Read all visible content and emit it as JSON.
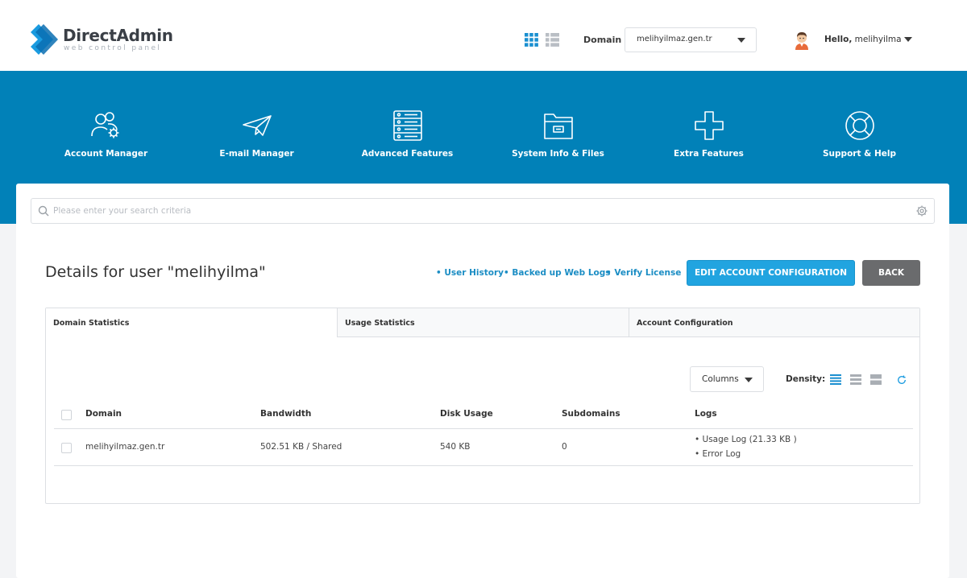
{
  "app": {
    "logo_title": "DirectAdmin",
    "logo_subtitle": "web control panel"
  },
  "header": {
    "domain_label": "Domain",
    "domain_value": "melihyilmaz.gen.tr",
    "hello_prefix": "Hello,",
    "username": "melihyilma"
  },
  "nav": [
    {
      "label": "Account Manager",
      "icon": "users-gear-icon"
    },
    {
      "label": "E-mail Manager",
      "icon": "paper-plane-icon"
    },
    {
      "label": "Advanced Features",
      "icon": "server-icon"
    },
    {
      "label": "System Info & Files",
      "icon": "folder-icon"
    },
    {
      "label": "Extra Features",
      "icon": "plus-icon"
    },
    {
      "label": "Support & Help",
      "icon": "lifebuoy-icon"
    }
  ],
  "search": {
    "placeholder": "Please enter your search criteria"
  },
  "page": {
    "title": "Details for user \"melihyilma\"",
    "links": [
      "User History",
      "Backed up Web Logs",
      "Verify License"
    ],
    "edit_button": "EDIT ACCOUNT CONFIGURATION",
    "back_button": "BACK"
  },
  "tabs": [
    "Domain Statistics",
    "Usage Statistics",
    "Account Configuration"
  ],
  "active_tab": "Domain Statistics",
  "table": {
    "columns_button": "Columns",
    "density_label": "Density:",
    "headers": [
      "Domain",
      "Bandwidth",
      "Disk Usage",
      "Subdomains",
      "Logs"
    ],
    "rows": [
      {
        "domain": "melihyilmaz.gen.tr",
        "bandwidth": "502.51 KB / Shared",
        "disk_usage": "540 KB",
        "subdomains": "0",
        "logs": [
          "Usage Log (21.33 KB )",
          "Error Log"
        ]
      }
    ]
  },
  "colors": {
    "brand_blue": "#0181b8",
    "accent_button": "#21a4e0",
    "link": "#1b8dc4",
    "back_button": "#6a6b6d"
  }
}
